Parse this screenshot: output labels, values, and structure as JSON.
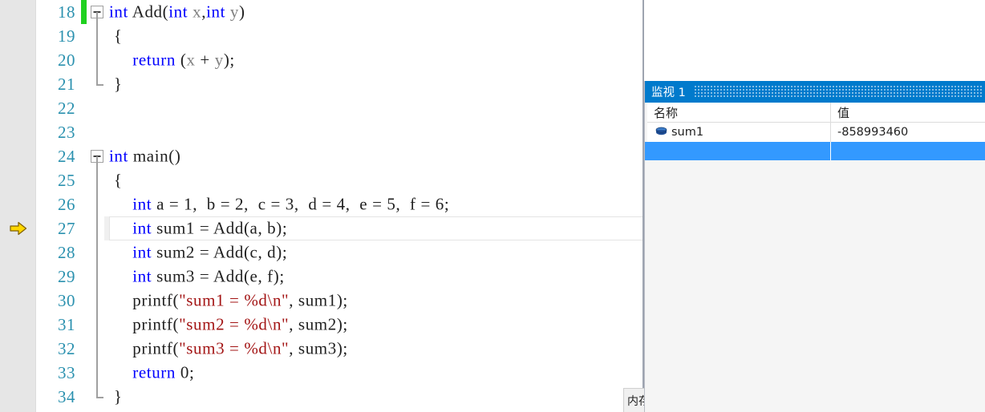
{
  "editor": {
    "name": "code-editor",
    "language": "c",
    "first_line_number": 18,
    "current_execution_line": 27,
    "lines": [
      {
        "number": "18",
        "changed": true,
        "fold": "open",
        "fold_line": false,
        "tokens": [
          {
            "t": "int",
            "c": "kw"
          },
          {
            "t": " ",
            "c": "plain"
          },
          {
            "t": "Add",
            "c": "plain"
          },
          {
            "t": "(",
            "c": "plain"
          },
          {
            "t": "int",
            "c": "kw"
          },
          {
            "t": " ",
            "c": "plain"
          },
          {
            "t": "x",
            "c": "var"
          },
          {
            "t": ",",
            "c": "plain"
          },
          {
            "t": "int",
            "c": "kw"
          },
          {
            "t": " ",
            "c": "plain"
          },
          {
            "t": "y",
            "c": "var"
          },
          {
            "t": ")",
            "c": "plain"
          }
        ]
      },
      {
        "number": "19",
        "changed": false,
        "fold": "none",
        "fold_line": true,
        "tokens": [
          {
            "t": " {",
            "c": "plain"
          }
        ]
      },
      {
        "number": "20",
        "changed": false,
        "fold": "none",
        "fold_line": true,
        "tokens": [
          {
            "t": "     ",
            "c": "plain"
          },
          {
            "t": "return",
            "c": "kw"
          },
          {
            "t": " (",
            "c": "plain"
          },
          {
            "t": "x",
            "c": "var"
          },
          {
            "t": " + ",
            "c": "plain"
          },
          {
            "t": "y",
            "c": "var"
          },
          {
            "t": ");",
            "c": "plain"
          }
        ]
      },
      {
        "number": "21",
        "changed": false,
        "fold": "none",
        "fold_line": "end",
        "tokens": [
          {
            "t": " }",
            "c": "plain"
          }
        ]
      },
      {
        "number": "22",
        "changed": false,
        "fold": "none",
        "fold_line": false,
        "tokens": []
      },
      {
        "number": "23",
        "changed": false,
        "fold": "none",
        "fold_line": false,
        "tokens": []
      },
      {
        "number": "24",
        "changed": false,
        "fold": "open",
        "fold_line": false,
        "tokens": [
          {
            "t": "int",
            "c": "kw"
          },
          {
            "t": " ",
            "c": "plain"
          },
          {
            "t": "main",
            "c": "plain"
          },
          {
            "t": "()",
            "c": "plain"
          }
        ]
      },
      {
        "number": "25",
        "changed": false,
        "fold": "none",
        "fold_line": true,
        "tokens": [
          {
            "t": " {",
            "c": "plain"
          }
        ]
      },
      {
        "number": "26",
        "changed": false,
        "fold": "none",
        "fold_line": true,
        "tokens": [
          {
            "t": "     ",
            "c": "plain"
          },
          {
            "t": "int",
            "c": "kw"
          },
          {
            "t": " a = 1,  b = 2,  c = 3,  d = 4,  e = 5,  f = 6;",
            "c": "plain"
          }
        ]
      },
      {
        "number": "27",
        "changed": false,
        "fold": "none",
        "fold_line": true,
        "current": true,
        "tokens": [
          {
            "t": "     ",
            "c": "plain"
          },
          {
            "t": "int",
            "c": "kw"
          },
          {
            "t": " sum1 = Add(a, b);",
            "c": "plain"
          }
        ]
      },
      {
        "number": "28",
        "changed": false,
        "fold": "none",
        "fold_line": true,
        "tokens": [
          {
            "t": "     ",
            "c": "plain"
          },
          {
            "t": "int",
            "c": "kw"
          },
          {
            "t": " sum2 = Add(c, d);",
            "c": "plain"
          }
        ]
      },
      {
        "number": "29",
        "changed": false,
        "fold": "none",
        "fold_line": true,
        "tokens": [
          {
            "t": "     ",
            "c": "plain"
          },
          {
            "t": "int",
            "c": "kw"
          },
          {
            "t": " sum3 = Add(e, f);",
            "c": "plain"
          }
        ]
      },
      {
        "number": "30",
        "changed": false,
        "fold": "none",
        "fold_line": true,
        "tokens": [
          {
            "t": "     printf(",
            "c": "plain"
          },
          {
            "t": "\"sum1 = %d\\n\"",
            "c": "str"
          },
          {
            "t": ", sum1);",
            "c": "plain"
          }
        ]
      },
      {
        "number": "31",
        "changed": false,
        "fold": "none",
        "fold_line": true,
        "tokens": [
          {
            "t": "     printf(",
            "c": "plain"
          },
          {
            "t": "\"sum2 = %d\\n\"",
            "c": "str"
          },
          {
            "t": ", sum2);",
            "c": "plain"
          }
        ]
      },
      {
        "number": "32",
        "changed": false,
        "fold": "none",
        "fold_line": true,
        "tokens": [
          {
            "t": "     printf(",
            "c": "plain"
          },
          {
            "t": "\"sum3 = %d\\n\"",
            "c": "str"
          },
          {
            "t": ", sum3);",
            "c": "plain"
          }
        ]
      },
      {
        "number": "33",
        "changed": false,
        "fold": "none",
        "fold_line": true,
        "tokens": [
          {
            "t": "     ",
            "c": "plain"
          },
          {
            "t": "return",
            "c": "kw"
          },
          {
            "t": " 0;",
            "c": "plain"
          }
        ]
      },
      {
        "number": "34",
        "changed": false,
        "fold": "none",
        "fold_line": "end",
        "tokens": [
          {
            "t": " }",
            "c": "plain"
          }
        ]
      }
    ]
  },
  "watch_panel": {
    "title": "监视 1",
    "columns": [
      "名称",
      "值"
    ],
    "rows": [
      {
        "name": "sum1",
        "value": "-858993460",
        "selected": false
      },
      {
        "name": "",
        "value": "",
        "selected": true
      }
    ]
  },
  "bottom_tab": {
    "label": "内存"
  },
  "colors": {
    "accent": "#007acc",
    "selection": "#3399ff",
    "keyword": "#0000ff",
    "string": "#a31515",
    "linenumber": "#2b91af",
    "identifier_gray": "#808080",
    "change_bar": "#1fd11f",
    "exec_arrow": "#ffd700",
    "gutter": "#e6e6e6",
    "panel_bg": "#f5f5f5"
  }
}
